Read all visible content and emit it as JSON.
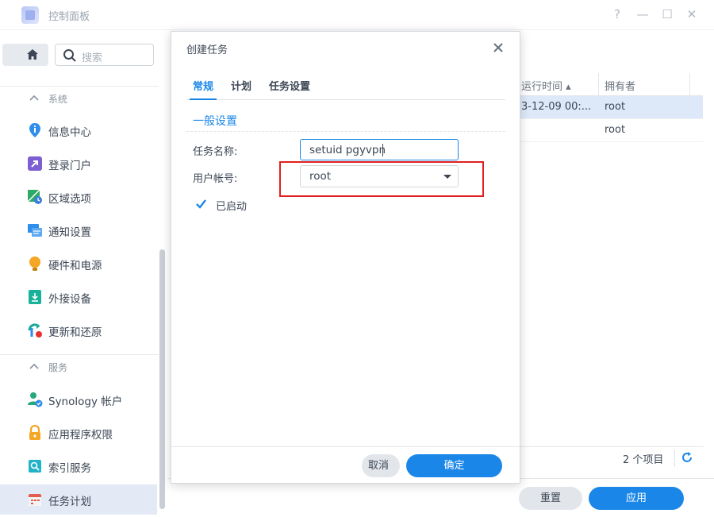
{
  "window": {
    "title": "控制面板",
    "help_glyph": "?",
    "minimize_glyph": "—",
    "maximize_glyph": "☐",
    "close_glyph": "✕"
  },
  "sidebar": {
    "search_placeholder": "搜索",
    "section_system": "系统",
    "section_services": "服务",
    "items": [
      {
        "label": "信息中心",
        "icon": "info-center-icon"
      },
      {
        "label": "登录门户",
        "icon": "login-portal-icon"
      },
      {
        "label": "区域选项",
        "icon": "regional-options-icon"
      },
      {
        "label": "通知设置",
        "icon": "notification-icon"
      },
      {
        "label": "硬件和电源",
        "icon": "hardware-power-icon"
      },
      {
        "label": "外接设备",
        "icon": "external-devices-icon"
      },
      {
        "label": "更新和还原",
        "icon": "update-restore-icon"
      },
      {
        "label": "Synology 帐户",
        "icon": "synology-account-icon"
      },
      {
        "label": "应用程序权限",
        "icon": "app-privileges-icon"
      },
      {
        "label": "索引服务",
        "icon": "indexing-service-icon"
      },
      {
        "label": "任务计划",
        "icon": "task-scheduler-icon"
      }
    ]
  },
  "background_table": {
    "columns": [
      "运行时间 ▴",
      "拥有者"
    ],
    "rows": [
      {
        "time": "3-12-09 00:...",
        "owner": "root"
      },
      {
        "time": "",
        "owner": "root"
      }
    ],
    "item_count": "2 个项目"
  },
  "footer": {
    "reset_label": "重置",
    "apply_label": "应用"
  },
  "dialog": {
    "title": "创建任务",
    "tabs": [
      "常规",
      "计划",
      "任务设置"
    ],
    "section_title": "一般设置",
    "task_name_label": "任务名称:",
    "task_name_value": "setuid pgyvpn",
    "user_label": "用户帐号:",
    "user_value": "root",
    "enabled_label": "已启动",
    "enabled": true,
    "cancel_label": "取消",
    "ok_label": "确定"
  },
  "colors": {
    "accent": "#1a87e8",
    "highlight_box": "#e02020"
  }
}
